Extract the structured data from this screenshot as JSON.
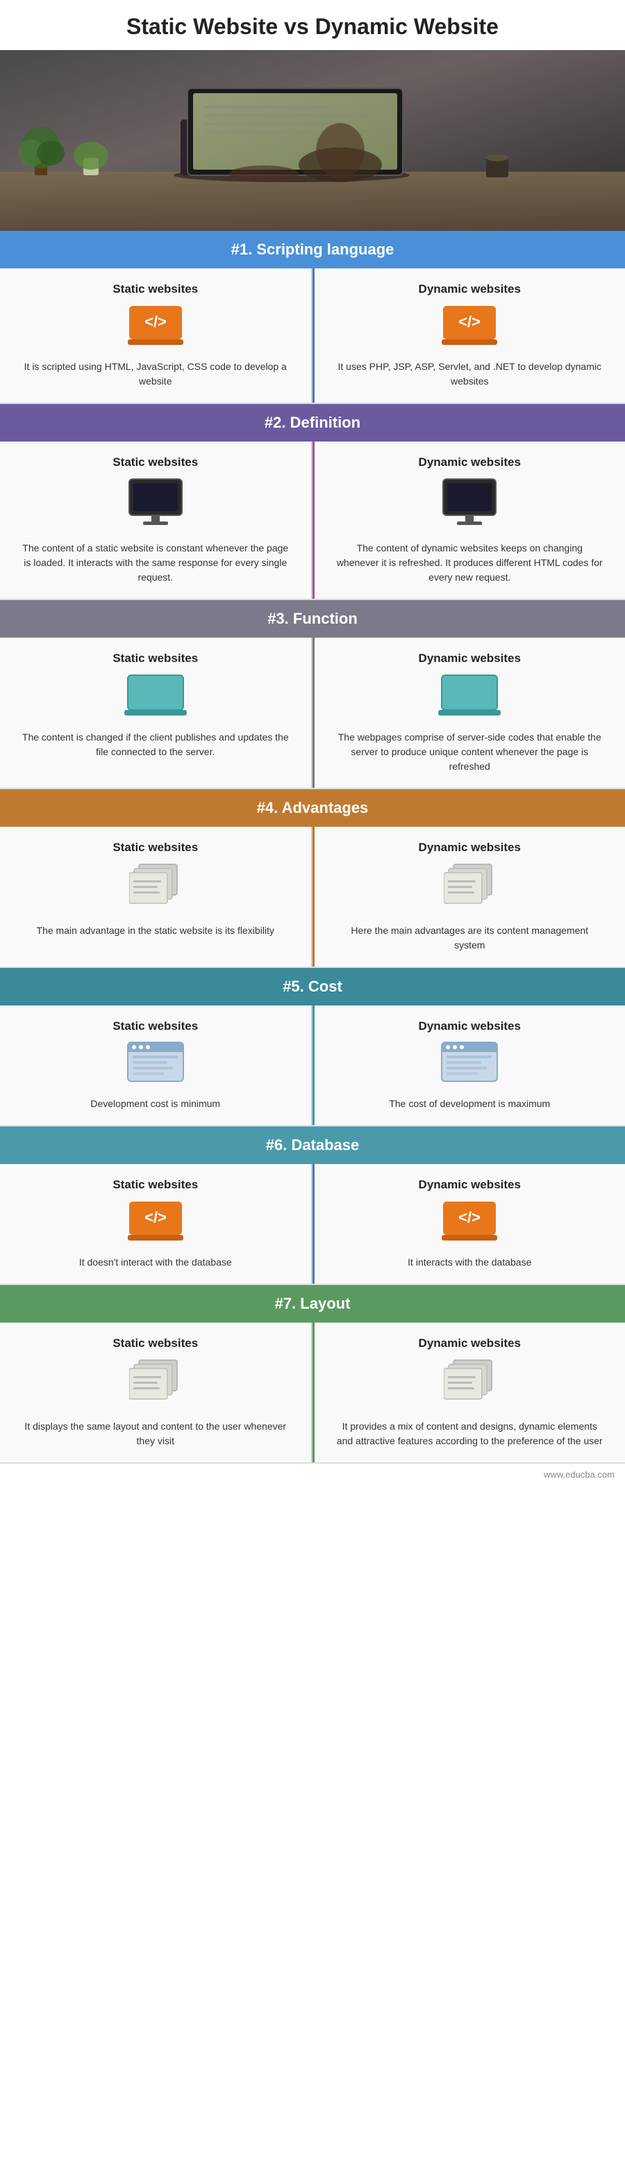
{
  "title": "Static Website vs Dynamic Website",
  "hero": {
    "alt": "Person typing on laptop at desk"
  },
  "sections": [
    {
      "id": "scripting",
      "number": "#1.",
      "label": "Scripting language",
      "headerClass": "header-blue",
      "dividerClass": "vert-divider-blue",
      "static": {
        "title": "Static websites",
        "icon": "code-laptop-orange",
        "text": "It is scripted using HTML, JavaScript, CSS code to develop a website"
      },
      "dynamic": {
        "title": "Dynamic websites",
        "icon": "code-laptop-orange",
        "text": "It uses PHP, JSP, ASP, Servlet, and .NET to develop dynamic websites"
      }
    },
    {
      "id": "definition",
      "number": "#2.",
      "label": "Definition",
      "headerClass": "header-purple",
      "dividerClass": "vert-divider",
      "static": {
        "title": "Static websites",
        "icon": "monitor",
        "text": "The content of a static website is constant whenever the page is loaded. It interacts with the same response for every single request."
      },
      "dynamic": {
        "title": "Dynamic websites",
        "icon": "monitor",
        "text": "The content of dynamic websites keeps on changing whenever it is refreshed. It produces different HTML codes for every new request."
      }
    },
    {
      "id": "function",
      "number": "#3.",
      "label": "Function",
      "headerClass": "header-gray",
      "dividerClass": "vert-divider-gray",
      "static": {
        "title": "Static websites",
        "icon": "teal-laptop",
        "text": "The content is changed if the client publishes and updates the file connected to the server."
      },
      "dynamic": {
        "title": "Dynamic websites",
        "icon": "teal-laptop",
        "text": "The webpages comprise of server-side codes that enable the server to produce unique content whenever the page is refreshed"
      }
    },
    {
      "id": "advantages",
      "number": "#4.",
      "label": "Advantages",
      "headerClass": "header-brown",
      "dividerClass": "vert-divider-brown",
      "static": {
        "title": "Static websites",
        "icon": "files",
        "text": "The main advantage in the static website is its flexibility"
      },
      "dynamic": {
        "title": "Dynamic websites",
        "icon": "files",
        "text": "Here the main advantages are its content management system"
      }
    },
    {
      "id": "cost",
      "number": "#5.",
      "label": "Cost",
      "headerClass": "header-teal",
      "dividerClass": "vert-divider-teal",
      "static": {
        "title": "Static websites",
        "icon": "browser",
        "text": "Development cost is minimum"
      },
      "dynamic": {
        "title": "Dynamic websites",
        "icon": "browser",
        "text": "The cost of development is maximum"
      }
    },
    {
      "id": "database",
      "number": "#6.",
      "label": "Database",
      "headerClass": "header-teal2",
      "dividerClass": "vert-divider-blue",
      "static": {
        "title": "Static websites",
        "icon": "code-laptop-orange",
        "text": "It doesn't interact with the database"
      },
      "dynamic": {
        "title": "Dynamic websites",
        "icon": "code-laptop-orange",
        "text": "It interacts with the database"
      }
    },
    {
      "id": "layout",
      "number": "#7.",
      "label": "Layout",
      "headerClass": "header-green",
      "dividerClass": "vert-divider-green",
      "static": {
        "title": "Static websites",
        "icon": "files",
        "text": "It displays the same layout and content to the user whenever they visit"
      },
      "dynamic": {
        "title": "Dynamic websites",
        "icon": "files",
        "text": "It provides a mix of content and designs, dynamic elements and attractive features according to the preference of the user"
      }
    }
  ],
  "footer": {
    "url": "www.educba.com"
  }
}
